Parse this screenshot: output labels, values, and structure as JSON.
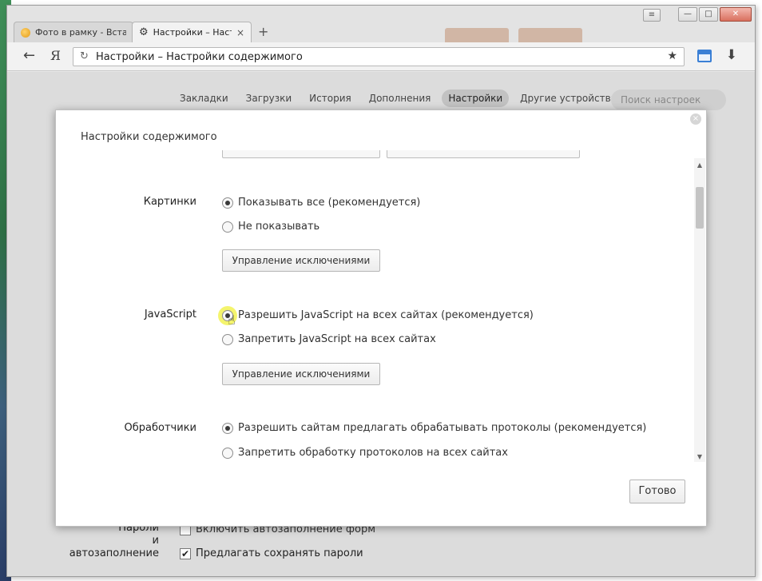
{
  "window": {
    "tabs": [
      {
        "title": "Фото в рамку - Вставить",
        "close": "×",
        "active": false
      },
      {
        "title": "Настройки – Настройки содержимого",
        "close": "×",
        "active": true
      }
    ],
    "new_tab": "+",
    "controls": {
      "menu": "≡",
      "minimize": "—",
      "maximize": "□",
      "close": "✕"
    }
  },
  "toolbar": {
    "back": "←",
    "yandex": "Я",
    "reload": "↻",
    "address": "Настройки – Настройки содержимого",
    "bookmark": "★",
    "download": "⬇"
  },
  "settings_nav": {
    "items": [
      "Закладки",
      "Загрузки",
      "История",
      "Дополнения",
      "Настройки",
      "Другие устройства"
    ],
    "active": "Настройки",
    "search_placeholder": "Поиск настроек"
  },
  "background_page": {
    "passwords_label": "Пароли\nи автозаполнение",
    "autofill_option": "Включить автозаполнение форм",
    "save_passwords_option": "Предлагать сохранять пароли",
    "save_passwords_checked": "✔"
  },
  "dialog": {
    "title": "Настройки содержимого",
    "close": "×",
    "sections": [
      {
        "label": "Картинки",
        "options": [
          "Показывать все (рекомендуется)",
          "Не показывать"
        ],
        "selected": 0,
        "button": "Управление исключениями"
      },
      {
        "label": "JavaScript",
        "options": [
          "Разрешить JavaScript на всех сайтах (рекомендуется)",
          "Запретить JavaScript на всех сайтах"
        ],
        "selected": 0,
        "button": "Управление исключениями"
      },
      {
        "label": "Обработчики",
        "options": [
          "Разрешить сайтам предлагать обрабатывать протоколы (рекомендуется)",
          "Запретить обработку протоколов на всех сайтах"
        ],
        "selected": 0
      }
    ],
    "done": "Готово"
  }
}
